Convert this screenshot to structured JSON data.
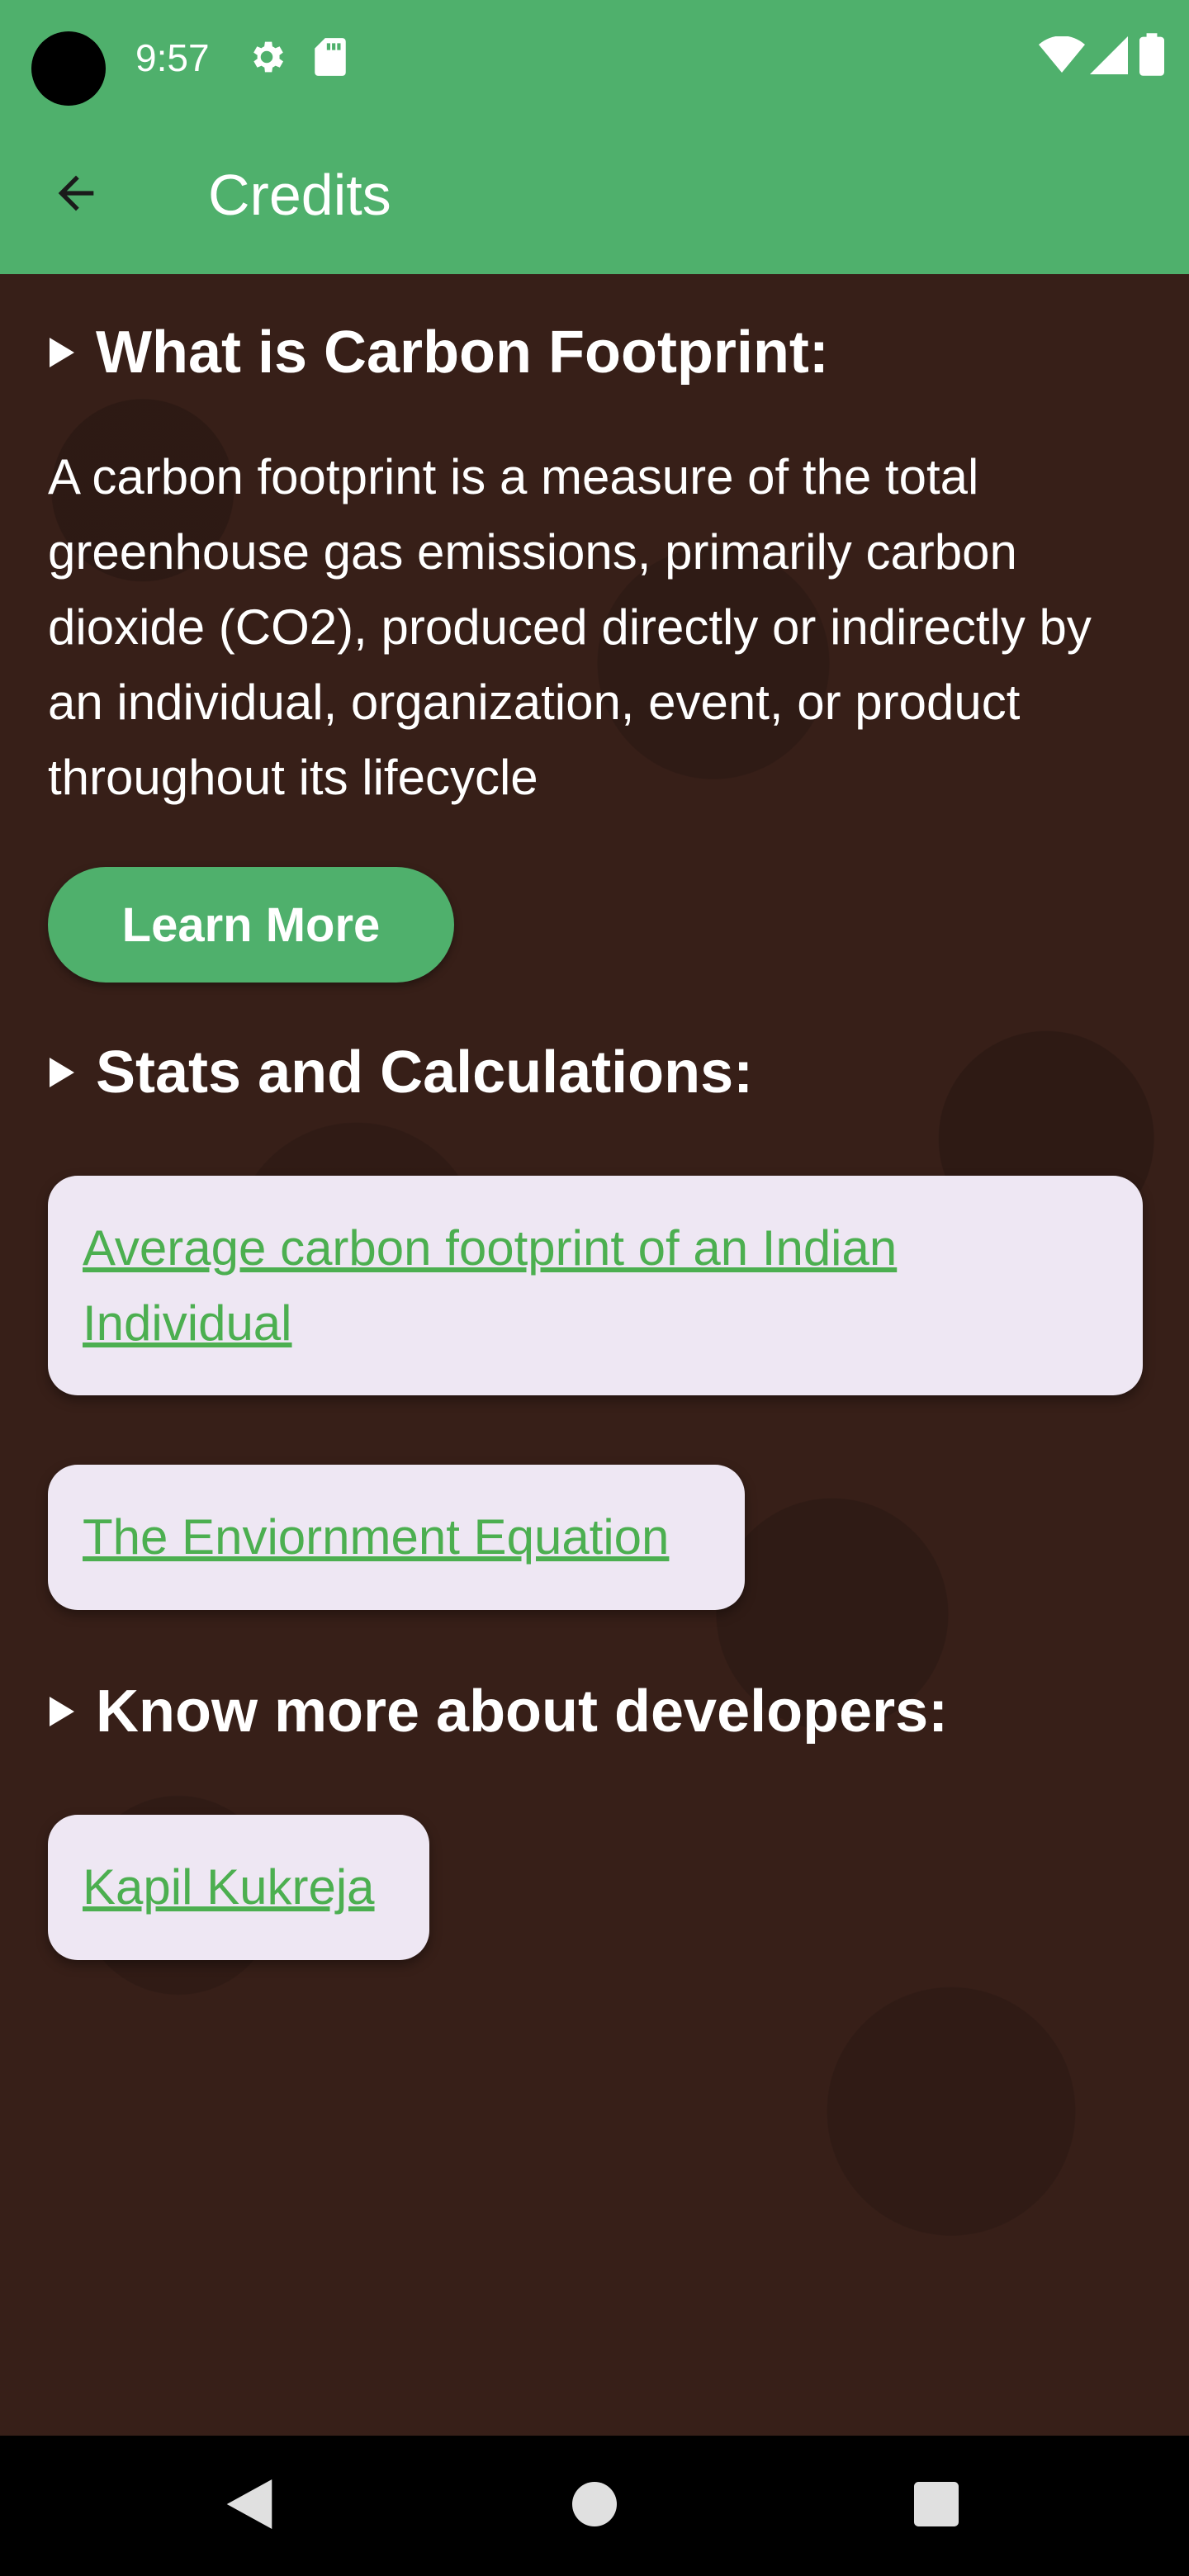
{
  "status_bar": {
    "time": "9:57",
    "left_icons": [
      "gear-icon",
      "sd-card-icon"
    ],
    "right_icons": [
      "wifi-icon",
      "signal-icon",
      "battery-icon"
    ]
  },
  "app_bar": {
    "title": "Credits",
    "back_icon": "arrow-back-icon",
    "color": "#4fb06c"
  },
  "sections": [
    {
      "heading": "What is Carbon Footprint:",
      "body": "A carbon footprint is a measure of the total greenhouse gas emissions, primarily carbon dioxide (CO2), produced directly or indirectly by an individual, organization, event, or product throughout its lifecycle",
      "button_label": "Learn More"
    },
    {
      "heading": "Stats and Calculations:",
      "links": [
        "Average carbon footprint of an Indian Individual",
        "The Enviornment Equation"
      ]
    },
    {
      "heading": "Know more about developers:",
      "links": [
        "Kapil Kukreja"
      ]
    }
  ],
  "colors": {
    "accent": "#4fb06c",
    "link": "#4caf50",
    "card": "#eee7f3",
    "background": "#371f18"
  },
  "nav_bar": {
    "icons": [
      "back-triangle-icon",
      "home-circle-icon",
      "recents-square-icon"
    ]
  }
}
